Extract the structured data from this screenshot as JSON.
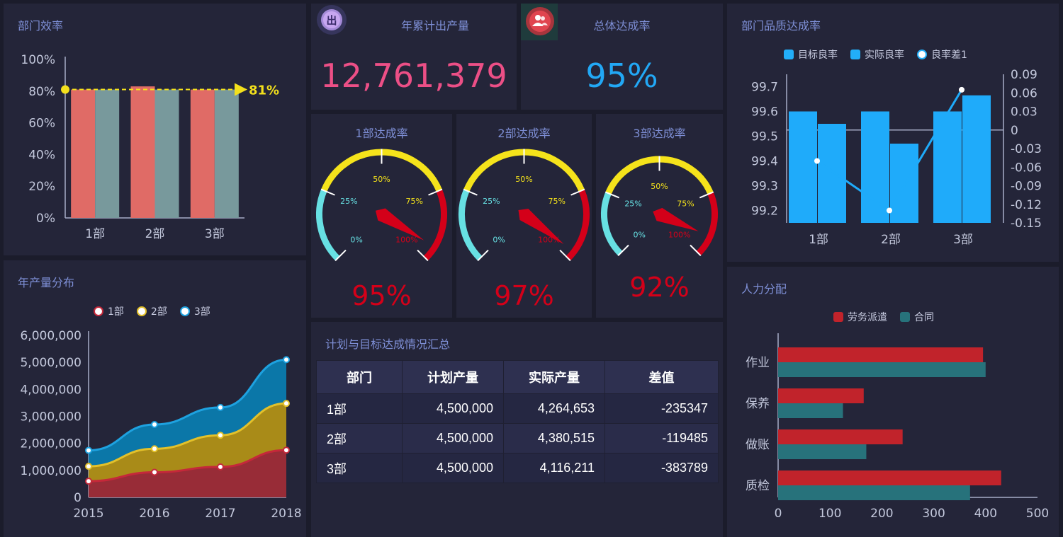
{
  "efficiency": {
    "title": "部门效率",
    "marker_label": "81%",
    "chart_data": {
      "type": "bar",
      "categories": [
        "1部",
        "2部",
        "3部"
      ],
      "series": [
        {
          "values": [
            81,
            83,
            81
          ]
        },
        {
          "values": [
            81,
            81,
            81
          ]
        }
      ],
      "yticks": [
        "0%",
        "20%",
        "40%",
        "60%",
        "80%",
        "100%"
      ],
      "ylim": [
        0,
        100
      ],
      "markline": 81,
      "colors": [
        "#e06b66",
        "#78999c"
      ]
    }
  },
  "output_total": {
    "title": "年累计出产量",
    "value": "12,761,379",
    "color": "#ec4f86",
    "icon": "output-badge-icon",
    "icon_text": "出"
  },
  "overall_rate": {
    "title": "总体达成率",
    "value": "95%",
    "color": "#22a8f5",
    "icon": "team-icon"
  },
  "gauges": [
    {
      "title": "1部达成率",
      "value": 95,
      "label": "95%"
    },
    {
      "title": "2部达成率",
      "value": 97,
      "label": "97%"
    },
    {
      "title": "3部达成率",
      "value": 92,
      "label": "92%"
    }
  ],
  "gauge_ticks": [
    "0%",
    "25%",
    "50%",
    "75%",
    "100%"
  ],
  "quality": {
    "title": "部门品质达成率",
    "legend": [
      "目标良率",
      "实际良率",
      "良率差1"
    ],
    "chart_data": {
      "type": "bar",
      "categories": [
        "1部",
        "2部",
        "3部"
      ],
      "series": [
        {
          "name": "目标良率",
          "values": [
            99.6,
            99.6,
            99.6
          ]
        },
        {
          "name": "实际良率",
          "values": [
            99.55,
            99.47,
            99.665
          ]
        },
        {
          "name": "良率差1",
          "type": "line",
          "axis": "right",
          "values": [
            -0.05,
            -0.13,
            0.065
          ]
        }
      ],
      "ylim": [
        99.15,
        99.75
      ],
      "yticks": [
        "99.2",
        "99.3",
        "99.4",
        "99.5",
        "99.6",
        "99.7"
      ],
      "y2ticks": [
        "-0.15",
        "-0.12",
        "-0.09",
        "-0.06",
        "-0.03",
        "0",
        "0.03",
        "0.06",
        "0.09"
      ],
      "y2lim": [
        -0.15,
        0.09
      ]
    }
  },
  "yearly": {
    "title": "年产量分布",
    "legend": [
      "1部",
      "2部",
      "3部"
    ],
    "chart_data": {
      "type": "area",
      "x": [
        "2015",
        "2016",
        "2017",
        "2018"
      ],
      "series": [
        {
          "name": "1部",
          "values": [
            600000,
            930000,
            1130000,
            1750000
          ]
        },
        {
          "name": "2部",
          "values": [
            1150000,
            1800000,
            2300000,
            3480000
          ]
        },
        {
          "name": "3部",
          "values": [
            1740000,
            2700000,
            3330000,
            5100000
          ]
        }
      ],
      "yticks": [
        "0",
        "1,000,000",
        "2,000,000",
        "3,000,000",
        "4,000,000",
        "5,000,000",
        "6,000,000"
      ],
      "ylim": [
        0,
        6000000
      ],
      "colors": [
        "#982c37",
        "#a98b18",
        "#0b77a8"
      ],
      "line_colors": [
        "#c5283a",
        "#e3c12a",
        "#1ea2e0"
      ]
    }
  },
  "summary": {
    "title": "计划与目标达成情况汇总",
    "headers": [
      "部门",
      "计划产量",
      "实际产量",
      "差值"
    ],
    "rows": [
      [
        "1部",
        "4,500,000",
        "4,264,653",
        "-235347"
      ],
      [
        "2部",
        "4,500,000",
        "4,380,515",
        "-119485"
      ],
      [
        "3部",
        "4,500,000",
        "4,116,211",
        "-383789"
      ]
    ]
  },
  "manpower": {
    "title": "人力分配",
    "legend": [
      "劳务派遣",
      "合同"
    ],
    "chart_data": {
      "type": "bar",
      "orientation": "horizontal",
      "categories": [
        "作业",
        "保养",
        "做账",
        "质检"
      ],
      "series": [
        {
          "name": "劳务派遣",
          "values": [
            395,
            165,
            240,
            430
          ]
        },
        {
          "name": "合同",
          "values": [
            400,
            125,
            170,
            370
          ]
        }
      ],
      "xticks": [
        "0",
        "100",
        "200",
        "300",
        "400",
        "500"
      ],
      "xlim": [
        0,
        500
      ],
      "colors": [
        "#c1232b",
        "#27727b"
      ]
    }
  }
}
